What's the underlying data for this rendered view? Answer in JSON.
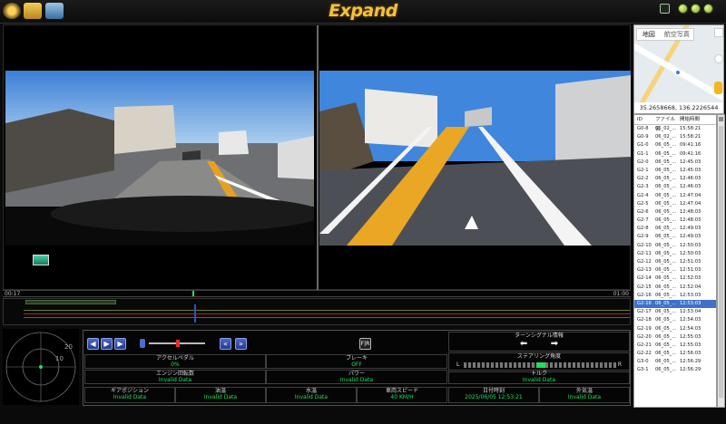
{
  "app": {
    "title": "Expand"
  },
  "icons": {
    "toolbar": [
      "eject-icon",
      "folder-icon",
      "printer-icon"
    ]
  },
  "map": {
    "tabs": [
      "地図",
      "航空写真"
    ],
    "coordinates": "35.2658668, 136.2226544"
  },
  "timeline": {
    "start": "00:17",
    "end": "01:00"
  },
  "radar": {
    "ring_labels": [
      "20",
      "10"
    ]
  },
  "panel": {
    "fr_label": "F|R",
    "accel": {
      "label": "アクセルペダル",
      "value": "0%"
    },
    "brake": {
      "label": "ブレーキ",
      "value": "OFF"
    },
    "rpm": {
      "label": "エンジン回転数",
      "value": "Invalid Data"
    },
    "power": {
      "label": "パワー",
      "value": "Invalid Data"
    },
    "torque": {
      "label": "トルク",
      "value": "Invalid Data"
    },
    "turn_signal": {
      "label": "ターンシグナル情報"
    },
    "steering": {
      "label": "ステアリング角度",
      "left": "L",
      "right": "R"
    },
    "gear": {
      "label": "ギアポジション",
      "value": "Invalid Data"
    },
    "oil_temp": {
      "label": "油温",
      "value": "Invalid Data"
    },
    "water_temp": {
      "label": "水温",
      "value": "Invalid Data"
    },
    "speed": {
      "label": "車両スピード",
      "value": "40 KM/H"
    },
    "datetime": {
      "label": "日付時刻",
      "value": "2025/06/05 12:53:21"
    },
    "outside_temp": {
      "label": "外気温",
      "value": "Invalid Data"
    }
  },
  "file_list": {
    "headers": [
      "ID",
      "ファイル名",
      "開始時間"
    ],
    "selected_index": 21,
    "rows": [
      [
        "G0-8",
        "06_02_...",
        "15:58:21"
      ],
      [
        "G0-9",
        "06_02_...",
        "15:58:21"
      ],
      [
        "G1-0",
        "06_05_...",
        "09:41:16"
      ],
      [
        "G1-1",
        "06_05_...",
        "09:41:16"
      ],
      [
        "G2-0",
        "06_05_...",
        "12:45:03"
      ],
      [
        "G2-1",
        "06_05_...",
        "12:45:03"
      ],
      [
        "G2-2",
        "06_05_...",
        "12:46:03"
      ],
      [
        "G2-3",
        "06_05_...",
        "12:46:03"
      ],
      [
        "G2-4",
        "06_05_...",
        "12:47:04"
      ],
      [
        "G2-5",
        "06_05_...",
        "12:47:04"
      ],
      [
        "G2-6",
        "06_05_...",
        "12:48:03"
      ],
      [
        "G2-7",
        "06_05_...",
        "12:48:03"
      ],
      [
        "G2-8",
        "06_05_...",
        "12:49:03"
      ],
      [
        "G2-9",
        "06_05_...",
        "12:49:03"
      ],
      [
        "G2-10",
        "06_05_...",
        "12:50:03"
      ],
      [
        "G2-11",
        "06_05_...",
        "12:50:03"
      ],
      [
        "G2-12",
        "06_05_...",
        "12:51:03"
      ],
      [
        "G2-13",
        "06_05_...",
        "12:51:03"
      ],
      [
        "G2-14",
        "06_05_...",
        "12:52:03"
      ],
      [
        "G2-15",
        "06_05_...",
        "12:52:04"
      ],
      [
        "G2-16",
        "06_05_...",
        "12:53:03"
      ],
      [
        "G2-16",
        "06_05_...",
        "12:53:03"
      ],
      [
        "G2-17",
        "06_05_...",
        "12:53:04"
      ],
      [
        "G2-18",
        "06_05_...",
        "12:54:03"
      ],
      [
        "G2-19",
        "06_05_...",
        "12:54:03"
      ],
      [
        "G2-20",
        "06_05_...",
        "12:55:03"
      ],
      [
        "G2-21",
        "06_05_...",
        "12:55:03"
      ],
      [
        "G2-22",
        "06_05_...",
        "12:56:03"
      ],
      [
        "G3-0",
        "06_05_...",
        "12:56:29"
      ],
      [
        "G3-1",
        "06_05_...",
        "12:56:29"
      ]
    ]
  }
}
